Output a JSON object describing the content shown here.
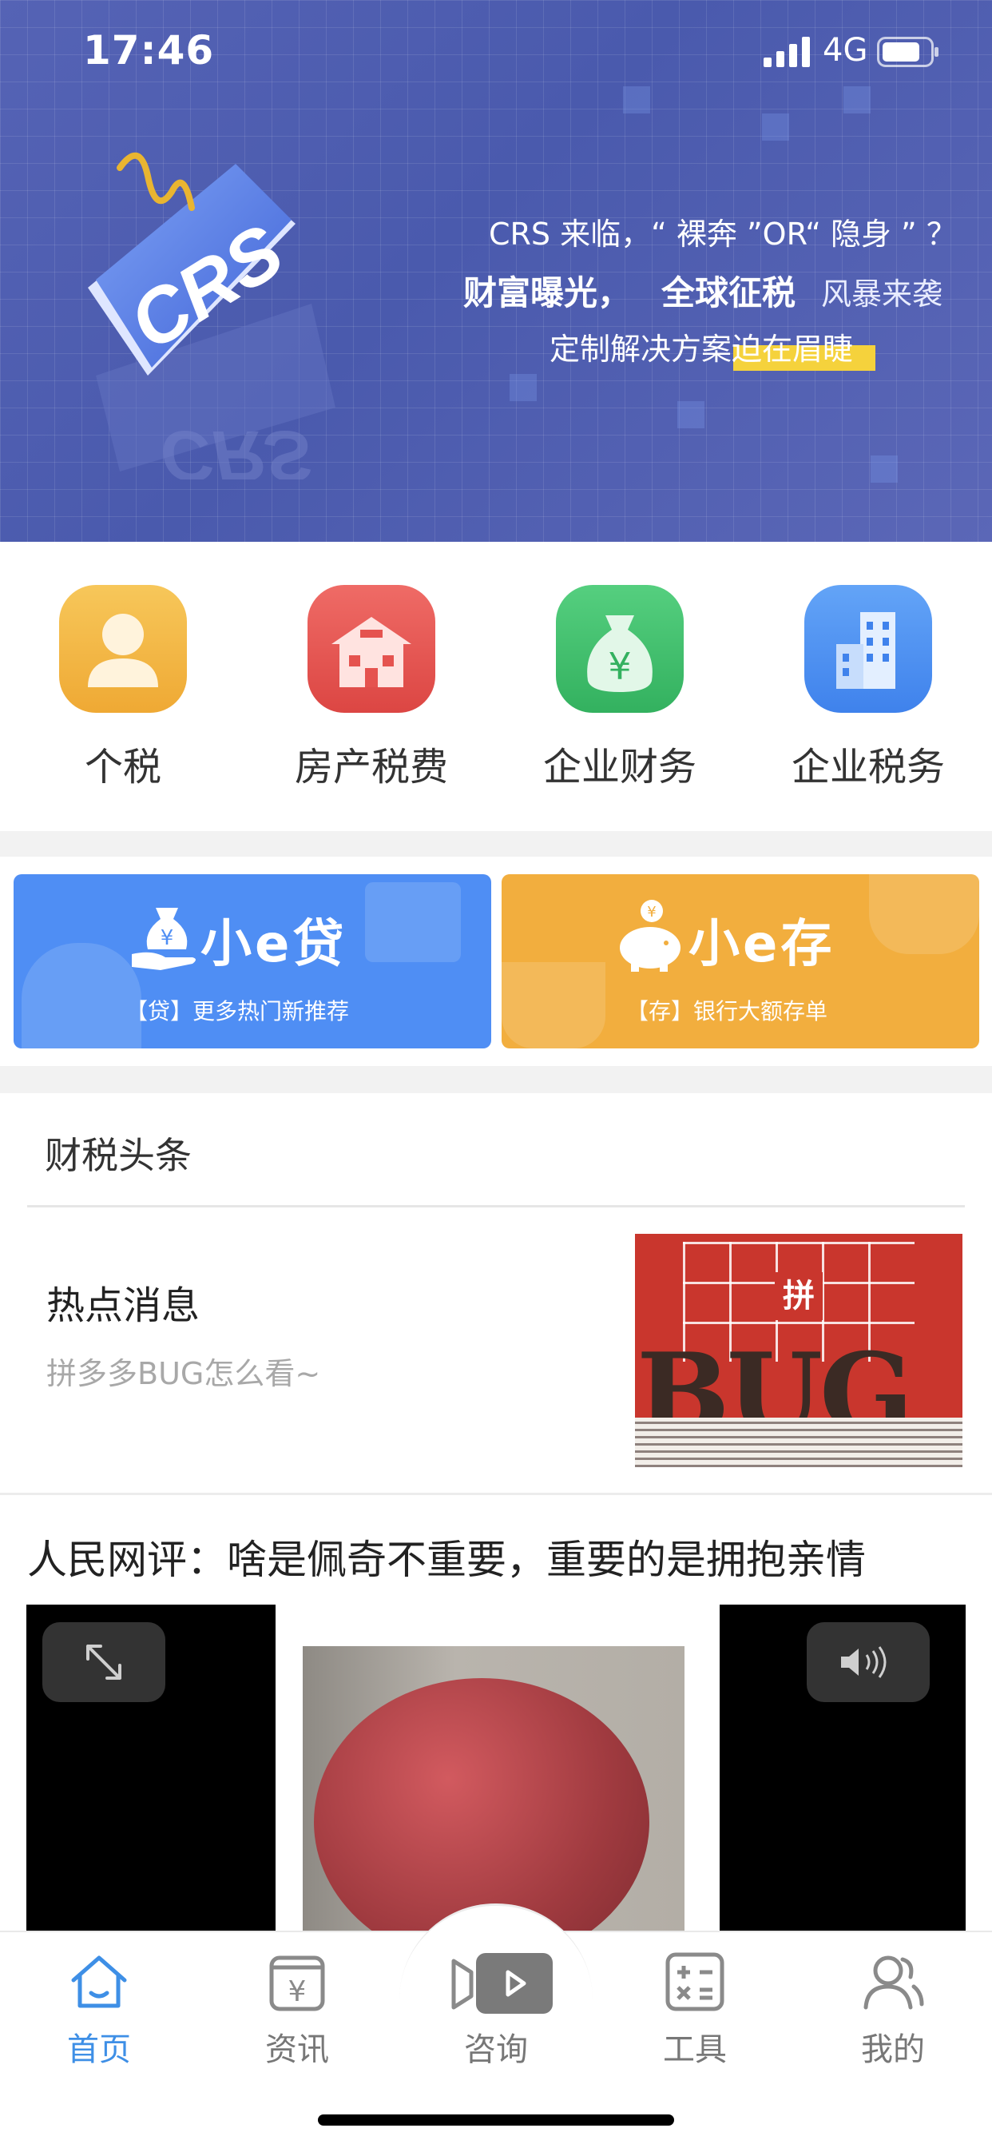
{
  "status_bar": {
    "time": "17:46",
    "network": "4G"
  },
  "banner": {
    "logo_text": "CRS",
    "line1": "CRS 来临，“ 裸奔 ”OR“ 隐身 ” ？",
    "line2a": "财富曝光，",
    "line2b": "全球征税",
    "line2c": "风暴来袭",
    "line3": "定制解决方案迫在眉睫"
  },
  "quick_entries": [
    {
      "label": "个税",
      "icon": "person-icon",
      "color": "#f3b645"
    },
    {
      "label": "房产税费",
      "icon": "house-icon",
      "color": "#e5534f"
    },
    {
      "label": "企业财务",
      "icon": "money-bag-icon",
      "color": "#3fbf6b"
    },
    {
      "label": "企业税务",
      "icon": "building-icon",
      "color": "#4a8ff0"
    }
  ],
  "promos": [
    {
      "title": "小e贷",
      "subtitle": "【贷】更多热门新推荐",
      "icon": "hand-money-icon",
      "color": "#4f8ef4"
    },
    {
      "title": "小e存",
      "subtitle": "【存】银行大额存单",
      "icon": "piggy-bank-icon",
      "color": "#f2ae3e"
    }
  ],
  "news": {
    "header": "财税头条",
    "hot": {
      "title": "热点消息",
      "subtitle": "拼多多BUG怎么看~",
      "image_center_char": "拼",
      "image_text": "BUG"
    },
    "video": {
      "title": "人民网评：啥是佩奇不重要，重要的是拥抱亲情"
    }
  },
  "tabbar": {
    "active_color": "#3e8fe6",
    "items": [
      {
        "label": "首页",
        "icon": "home-icon",
        "active": true
      },
      {
        "label": "资讯",
        "icon": "yuan-news-icon",
        "active": false
      },
      {
        "label": "咨询",
        "icon": "video-consult-icon",
        "active": false
      },
      {
        "label": "工具",
        "icon": "calculator-icon",
        "active": false
      },
      {
        "label": "我的",
        "icon": "users-icon",
        "active": false
      }
    ]
  }
}
